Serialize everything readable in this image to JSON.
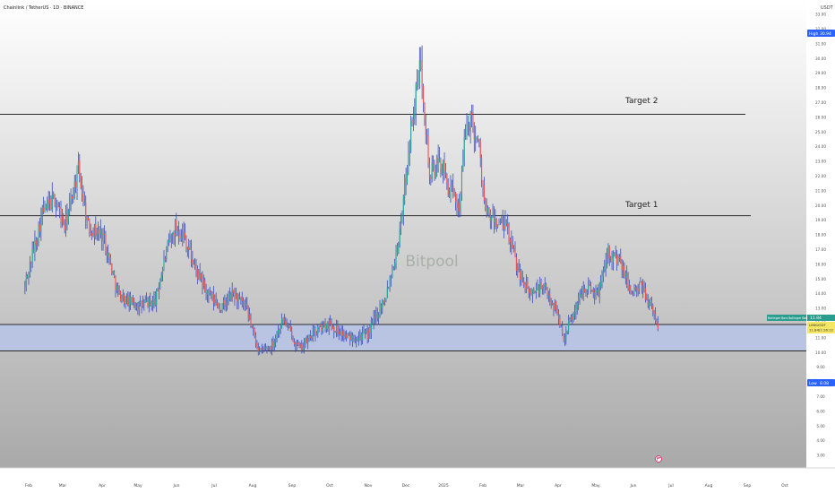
{
  "header": {
    "symbol_title": "Chainlink / TetherUS · 1D · BINANCE",
    "currency": "USDT"
  },
  "watermark": "Bitpool",
  "colors": {
    "up": "#26a69a",
    "down": "#ef5350",
    "wick": "#3d4fb8",
    "zone_fill": "#b7c3e8",
    "line": "#2b2b2b",
    "label_blue": "#2962ff",
    "label_green": "#2a9d8f",
    "label_yellow": "#f5e663"
  },
  "annotations": {
    "target2": "Target 2",
    "target1": "Target 1"
  },
  "price_labels": {
    "high_tag": "High",
    "high_value": "30.94",
    "low_tag": "Low",
    "low_value": "8.08",
    "indicator": "Bollinger Bars Bollinger Bars Body",
    "indicator_value": "11.84",
    "symbol_tag": "LINKUSDT",
    "symbol_value": "11.84",
    "countdown": "11:26:12"
  },
  "chart_data": {
    "type": "candlestick",
    "title": "Chainlink / TetherUS · 1D · BINANCE",
    "xlabel": "",
    "ylabel": "USDT",
    "ylim": [
      2.5,
      33.3
    ],
    "y_ticks": [
      "3.00",
      "4.00",
      "5.00",
      "6.00",
      "7.00",
      "8.00",
      "9.00",
      "10.00",
      "11.00",
      "12.00",
      "13.00",
      "14.00",
      "15.00",
      "16.00",
      "17.00",
      "18.00",
      "19.00",
      "20.00",
      "21.00",
      "22.00",
      "23.00",
      "24.00",
      "25.00",
      "26.00",
      "27.00",
      "28.00",
      "29.00",
      "30.00",
      "31.00",
      "32.00",
      "33.00"
    ],
    "x_ticks": [
      "Feb",
      "Mar",
      "Apr",
      "May",
      "Jun",
      "Jul",
      "Aug",
      "Sep",
      "Oct",
      "Nov",
      "Dec",
      "2025",
      "Feb",
      "Mar",
      "Apr",
      "May",
      "Jun",
      "Jul",
      "Aug",
      "Sep",
      "Oct"
    ],
    "horizontal_levels": [
      {
        "label": "Target 2",
        "price": 26.2
      },
      {
        "label": "Target 1",
        "price": 19.3
      },
      {
        "label": "",
        "price": 11.9
      },
      {
        "label": "",
        "price": 10.1
      }
    ],
    "support_zone": [
      10.1,
      11.9
    ],
    "series": [
      {
        "values": [
          {
            "x": "2024-01-29",
            "price": 14.5
          },
          {
            "x": "2024-02-12",
            "price": 19.5
          },
          {
            "x": "2024-02-22",
            "price": 20.5
          },
          {
            "x": "2024-03-01",
            "price": 18.5
          },
          {
            "x": "2024-03-08",
            "price": 21.0
          },
          {
            "x": "2024-03-12",
            "price": 22.5
          },
          {
            "x": "2024-03-20",
            "price": 18.5
          },
          {
            "x": "2024-04-01",
            "price": 18.0
          },
          {
            "x": "2024-04-13",
            "price": 14.0
          },
          {
            "x": "2024-04-20",
            "price": 13.5
          },
          {
            "x": "2024-05-01",
            "price": 13.2
          },
          {
            "x": "2024-05-13",
            "price": 13.5
          },
          {
            "x": "2024-05-21",
            "price": 16.5
          },
          {
            "x": "2024-05-29",
            "price": 18.6
          },
          {
            "x": "2024-06-05",
            "price": 18.0
          },
          {
            "x": "2024-06-15",
            "price": 15.5
          },
          {
            "x": "2024-06-24",
            "price": 14.0
          },
          {
            "x": "2024-07-05",
            "price": 13.0
          },
          {
            "x": "2024-07-15",
            "price": 14.0
          },
          {
            "x": "2024-07-25",
            "price": 13.0
          },
          {
            "x": "2024-08-05",
            "price": 10.0
          },
          {
            "x": "2024-08-15",
            "price": 10.5
          },
          {
            "x": "2024-08-24",
            "price": 12.3
          },
          {
            "x": "2024-09-06",
            "price": 10.2
          },
          {
            "x": "2024-09-20",
            "price": 11.5
          },
          {
            "x": "2024-09-30",
            "price": 12.0
          },
          {
            "x": "2024-10-15",
            "price": 11.0
          },
          {
            "x": "2024-10-31",
            "price": 11.2
          },
          {
            "x": "2024-11-07",
            "price": 12.5
          },
          {
            "x": "2024-11-15",
            "price": 14.0
          },
          {
            "x": "2024-11-25",
            "price": 17.5
          },
          {
            "x": "2024-12-01",
            "price": 22.0
          },
          {
            "x": "2024-12-06",
            "price": 26.0
          },
          {
            "x": "2024-12-11",
            "price": 28.5
          },
          {
            "x": "2024-12-13",
            "price": 30.0
          },
          {
            "x": "2024-12-20",
            "price": 22.0
          },
          {
            "x": "2024-12-29",
            "price": 23.0
          },
          {
            "x": "2025-01-05",
            "price": 21.0
          },
          {
            "x": "2025-01-13",
            "price": 20.0
          },
          {
            "x": "2025-01-18",
            "price": 25.0
          },
          {
            "x": "2025-01-22",
            "price": 26.0
          },
          {
            "x": "2025-01-29",
            "price": 24.0
          },
          {
            "x": "2025-02-03",
            "price": 19.5
          },
          {
            "x": "2025-02-09",
            "price": 19.0
          },
          {
            "x": "2025-02-20",
            "price": 18.5
          },
          {
            "x": "2025-02-28",
            "price": 16.0
          },
          {
            "x": "2025-03-10",
            "price": 14.0
          },
          {
            "x": "2025-03-21",
            "price": 14.5
          },
          {
            "x": "2025-04-01",
            "price": 13.0
          },
          {
            "x": "2025-04-07",
            "price": 11.0
          },
          {
            "x": "2025-04-14",
            "price": 12.5
          },
          {
            "x": "2025-04-24",
            "price": 14.5
          },
          {
            "x": "2025-05-05",
            "price": 14.0
          },
          {
            "x": "2025-05-12",
            "price": 17.0
          },
          {
            "x": "2025-05-23",
            "price": 16.0
          },
          {
            "x": "2025-06-01",
            "price": 14.0
          },
          {
            "x": "2025-06-09",
            "price": 14.5
          },
          {
            "x": "2025-06-16",
            "price": 13.2
          },
          {
            "x": "2025-06-22",
            "price": 11.8
          }
        ]
      }
    ]
  }
}
